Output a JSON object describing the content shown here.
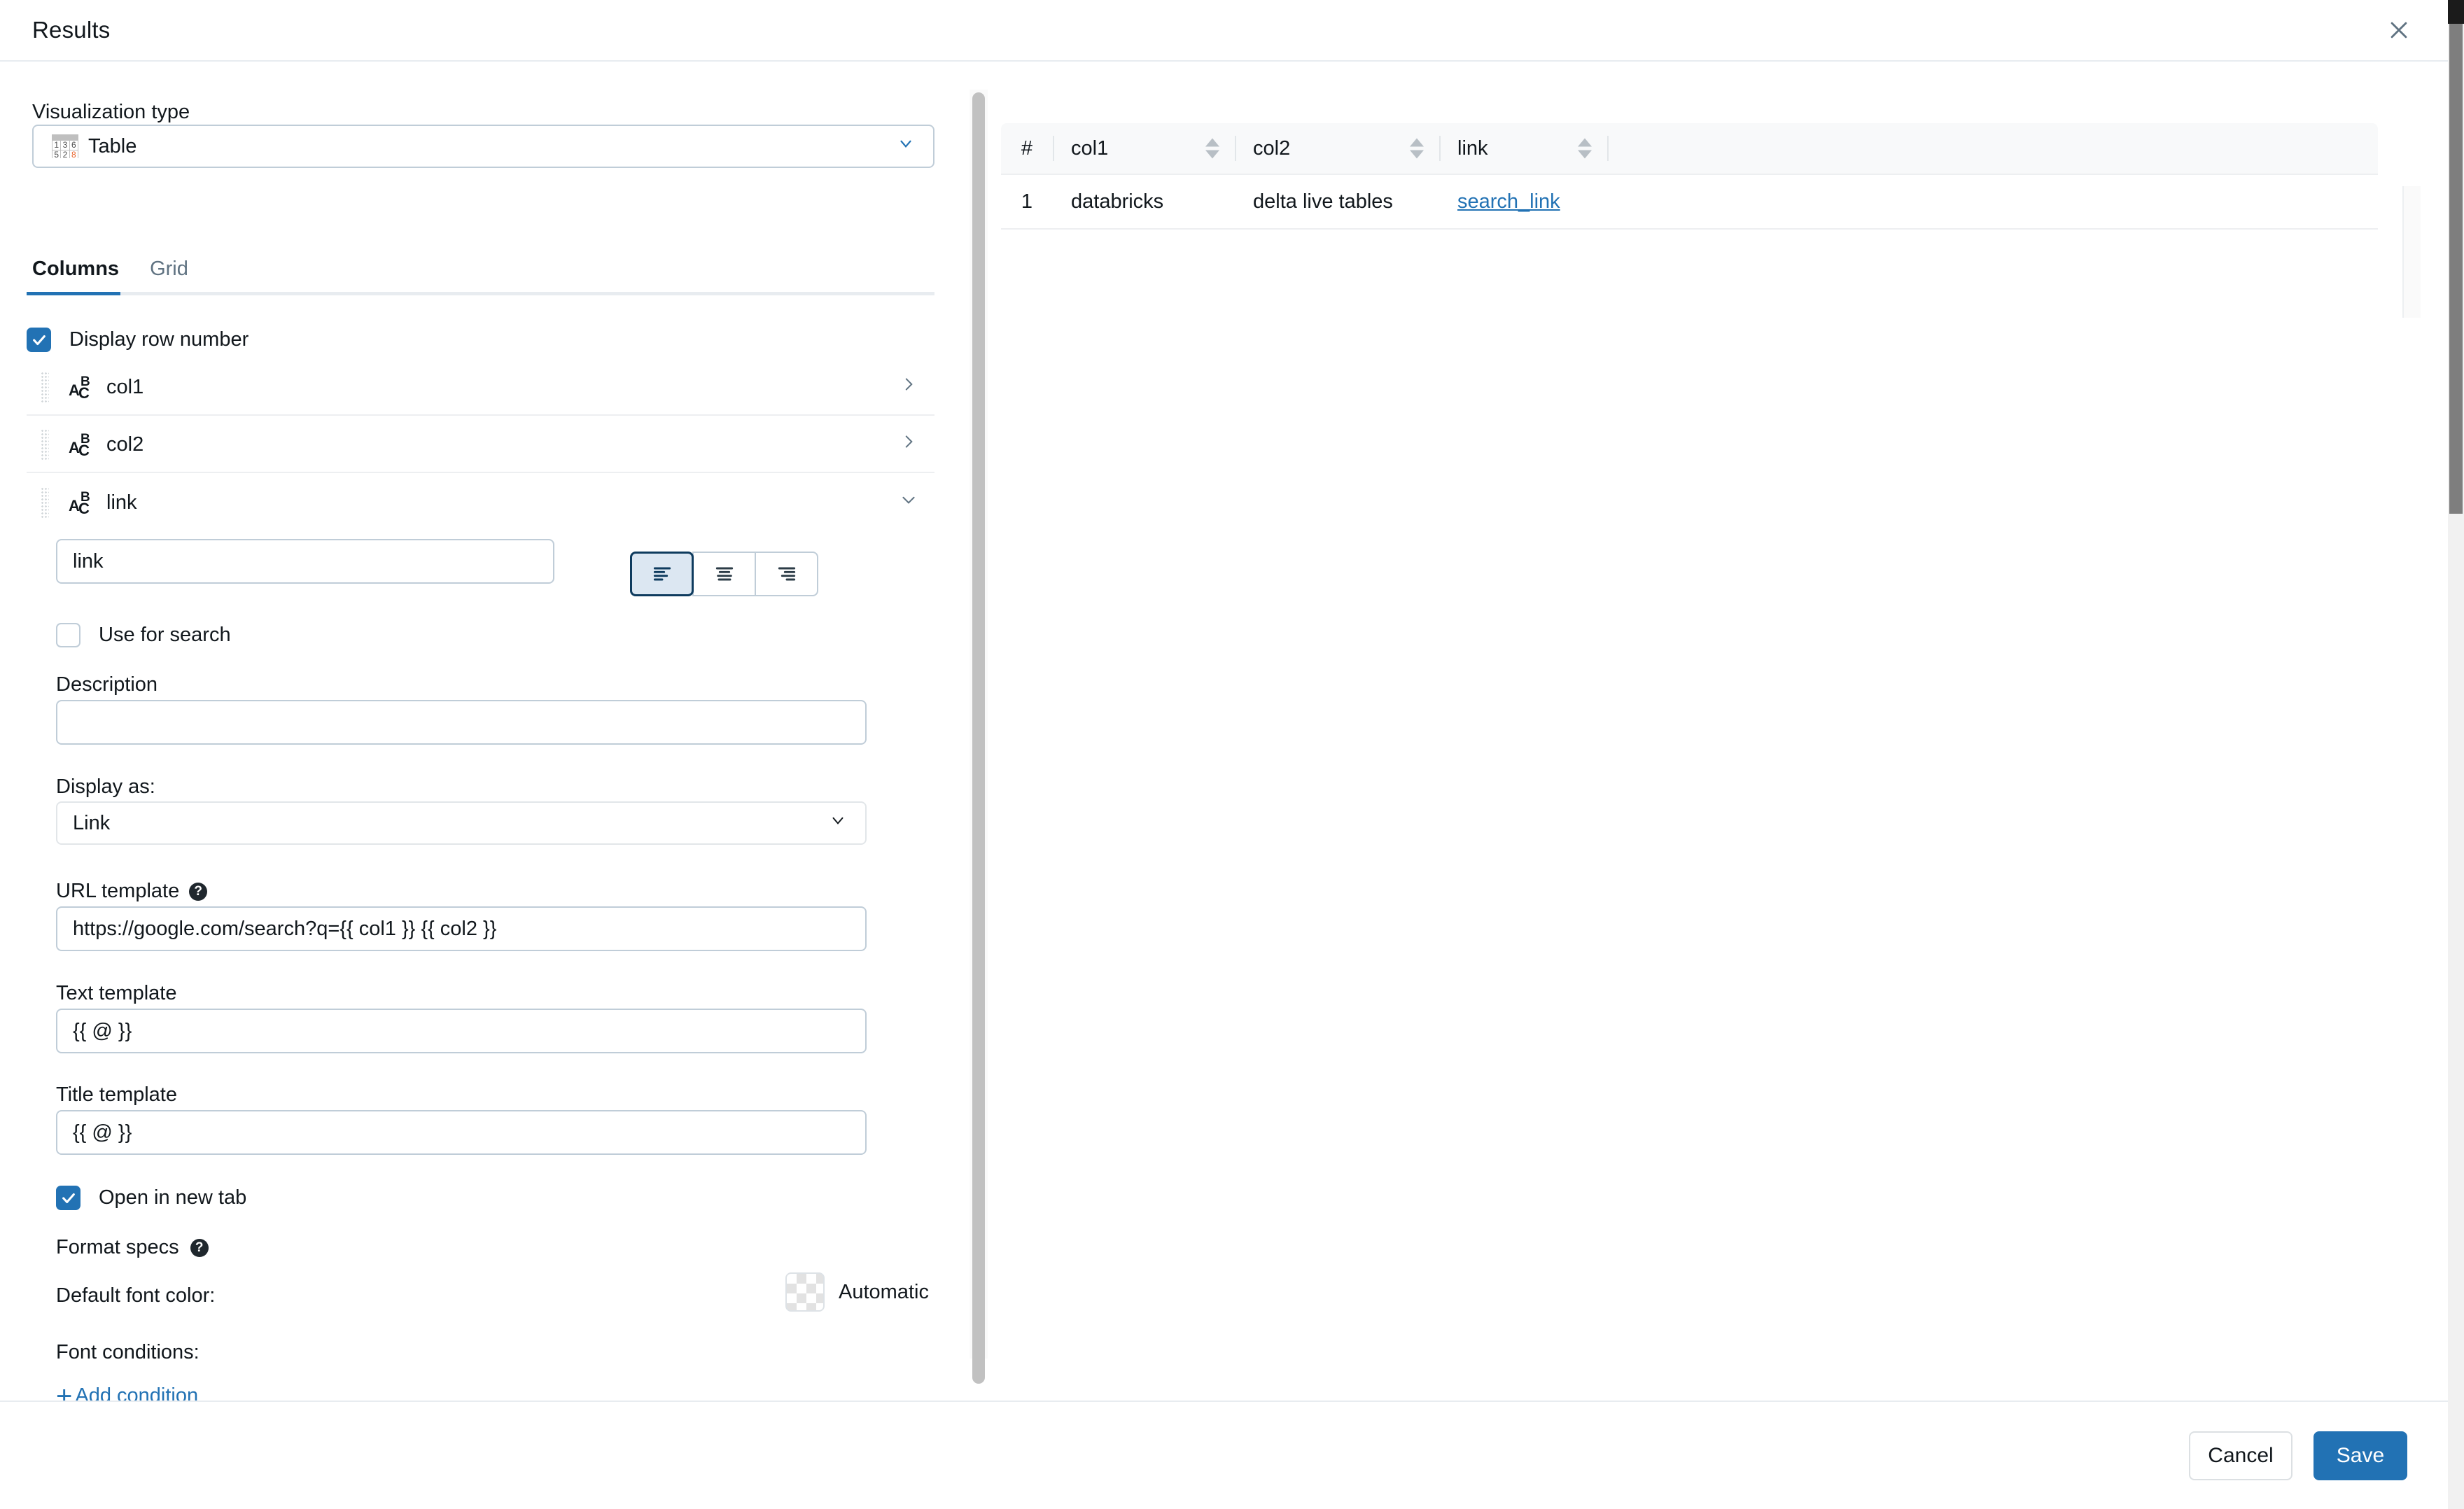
{
  "dialog": {
    "title": "Results",
    "close_icon": "close-icon"
  },
  "left_panel": {
    "viz_type": {
      "label": "Visualization type",
      "value": "Table",
      "icon": "table-icon",
      "glyph_cells": [
        "1",
        "3",
        "6",
        "5",
        "2",
        "8"
      ],
      "caret": "chevron-down-icon"
    },
    "tabs": [
      {
        "label": "Columns",
        "active": true
      },
      {
        "label": "Grid",
        "active": false
      }
    ],
    "display_row_number": {
      "label": "Display row number",
      "checked": true
    },
    "columns": [
      {
        "name": "col1",
        "type_icon": "abc-icon",
        "expanded": false,
        "chevron": "chevron-right-icon"
      },
      {
        "name": "col2",
        "type_icon": "abc-icon",
        "expanded": false,
        "chevron": "chevron-right-icon"
      },
      {
        "name": "link",
        "type_icon": "abc-icon",
        "expanded": true,
        "chevron": "chevron-down-icon"
      }
    ],
    "link_settings": {
      "title_value": "link",
      "alignment": {
        "options": [
          "align-left",
          "align-center",
          "align-right"
        ],
        "selected": "align-left"
      },
      "use_for_search": {
        "label": "Use for search",
        "checked": false
      },
      "description": {
        "label": "Description",
        "value": ""
      },
      "display_as": {
        "label": "Display as:",
        "value": "Link",
        "caret": "chevron-down-icon"
      },
      "url_template": {
        "label": "URL template",
        "help_icon": "help-icon",
        "value": "https://google.com/search?q={{ col1 }} {{ col2 }}"
      },
      "text_template": {
        "label": "Text template",
        "value": "{{ @ }}"
      },
      "title_template": {
        "label": "Title template",
        "value": "{{ @ }}"
      },
      "open_in_new_tab": {
        "label": "Open in new tab",
        "checked": true
      },
      "format_specs": {
        "label": "Format specs",
        "help_icon": "help-icon"
      },
      "default_font_color": {
        "label": "Default font color:",
        "value": "Automatic",
        "swatch": "transparent-checker"
      },
      "font_conditions": {
        "label": "Font conditions:",
        "add_label": "Add condition",
        "add_icon": "plus-icon"
      }
    }
  },
  "results": {
    "headers": [
      {
        "label": "#",
        "sortable": false
      },
      {
        "label": "col1",
        "sortable": true
      },
      {
        "label": "col2",
        "sortable": true
      },
      {
        "label": "link",
        "sortable": true
      }
    ],
    "rows": [
      {
        "num": "1",
        "col1": "databricks",
        "col2": "delta live tables",
        "link": "search_link"
      }
    ]
  },
  "footer": {
    "cancel_label": "Cancel",
    "save_label": "Save"
  },
  "colors": {
    "accent": "#2272B4",
    "link": "#2272B4",
    "border": "#C0CDD8",
    "text": "#11171C"
  }
}
